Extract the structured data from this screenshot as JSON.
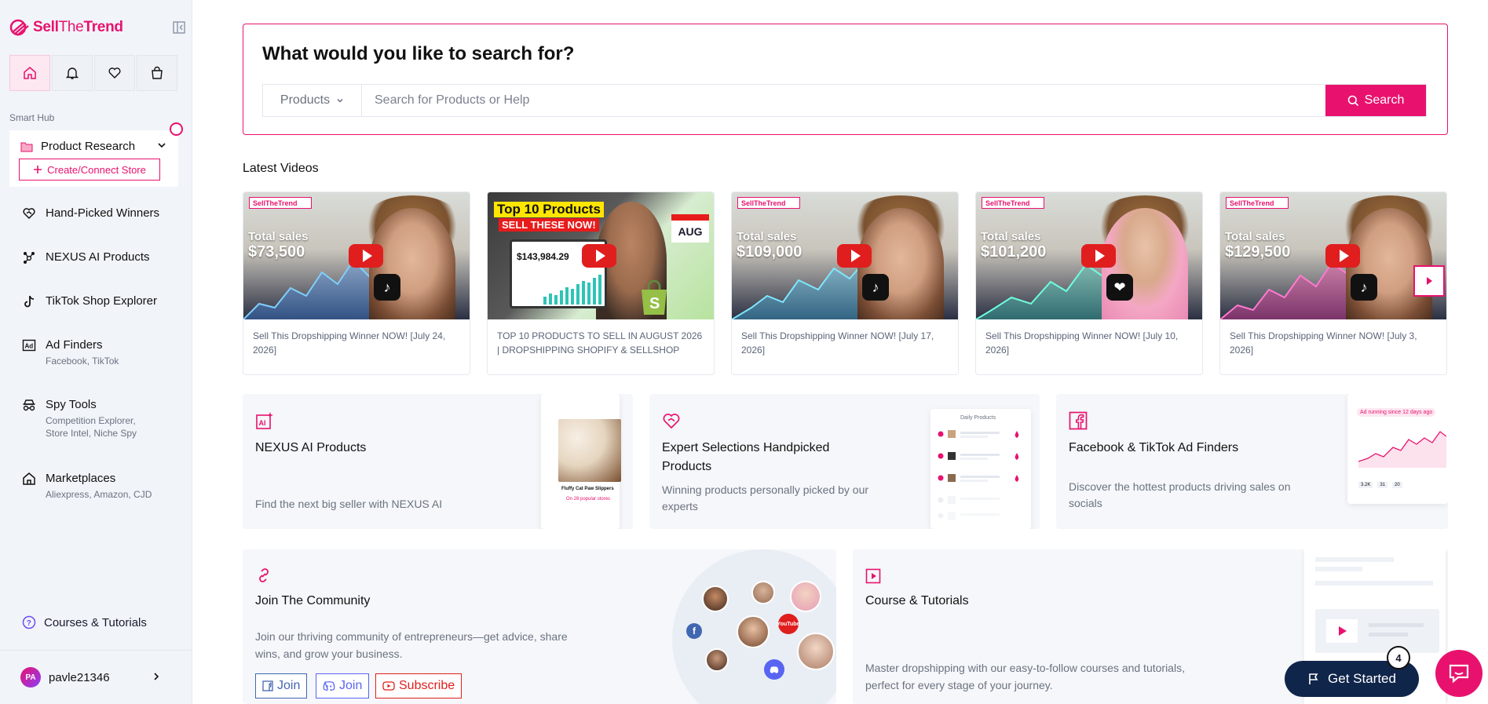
{
  "brand": {
    "name_part1": "Sell",
    "name_part2": "The",
    "name_part3": "Trend"
  },
  "sidebar": {
    "smart_hub_label": "Smart Hub",
    "research_label": "Product Research",
    "create_store_label": "Create/Connect Store",
    "nav": [
      {
        "label": "Hand-Picked Winners",
        "sub": ""
      },
      {
        "label": "NEXUS AI Products",
        "sub": ""
      },
      {
        "label": "TikTok Shop Explorer",
        "sub": ""
      },
      {
        "label": "Ad Finders",
        "sub": "Facebook, TikTok"
      },
      {
        "label": "Spy Tools",
        "sub": "Competition Explorer,",
        "sub2": "Store Intel, Niche Spy"
      },
      {
        "label": "Marketplaces",
        "sub": "Aliexpress, Amazon, CJD"
      }
    ],
    "courses_label": "Courses & Tutorials",
    "user": {
      "initials": "PA",
      "name": "pavle21346"
    }
  },
  "search": {
    "title": "What would you like to search for?",
    "category": "Products",
    "placeholder": "Search for Products or Help",
    "button": "Search"
  },
  "latest_label": "Latest Videos",
  "videos": [
    {
      "brand": "SellTheTrend",
      "total_label": "Total sales",
      "total": "$73,500",
      "badge": "tiktok",
      "caption": "Sell This Dropshipping Winner NOW! [July 24, 2026]"
    },
    {
      "top": "Top 10 Products",
      "sell": "SELL THESE NOW!",
      "month": "AUG",
      "amount": "$143,984.29",
      "caption": "TOP 10 PRODUCTS TO SELL IN AUGUST 2026 | DROPSHIPPING SHOPIFY & SELLSHOP"
    },
    {
      "brand": "SellTheTrend",
      "total_label": "Total sales",
      "total": "$109,000",
      "badge": "tiktok",
      "caption": "Sell This Dropshipping Winner NOW! [July 17, 2026]"
    },
    {
      "brand": "SellTheTrend",
      "total_label": "Total sales",
      "total": "$101,200",
      "badge": "heart",
      "caption": "Sell This Dropshipping Winner NOW! [July 10, 2026]"
    },
    {
      "brand": "SellTheTrend",
      "total_label": "Total sales",
      "total": "$129,500",
      "badge": "tiktok",
      "caption": "Sell This Dropshipping Winner NOW! [July 3, 2026]"
    }
  ],
  "features": [
    {
      "title": "NEXUS AI Products",
      "desc": "Find the next big seller with NEXUS AI",
      "mock_text": "Fluffy Cat Paw Slippers",
      "mock_sub": "On 28 popular stores"
    },
    {
      "title": "Expert Selections Handpicked Products",
      "desc": "Winning products personally picked by our experts",
      "mock_text": "Daily Products"
    },
    {
      "title": "Facebook & TikTok Ad Finders",
      "desc": "Discover the hottest products driving sales on socials",
      "mock_text": "Ad running since 12 days ago",
      "stats": [
        "3.2K",
        "31",
        "20"
      ]
    }
  ],
  "community": {
    "title": "Join The Community",
    "desc": "Join our thriving community of entrepreneurs—get advice, share wins, and grow your business.",
    "buttons": [
      "Join",
      "Join",
      "Subscribe"
    ],
    "youtube_label": "YouTube"
  },
  "course": {
    "title": "Course & Tutorials",
    "desc": "Master dropshipping with our easy-to-follow courses and tutorials, perfect for every stage of your journey."
  },
  "get_started": {
    "label": "Get Started",
    "badge": "4"
  }
}
